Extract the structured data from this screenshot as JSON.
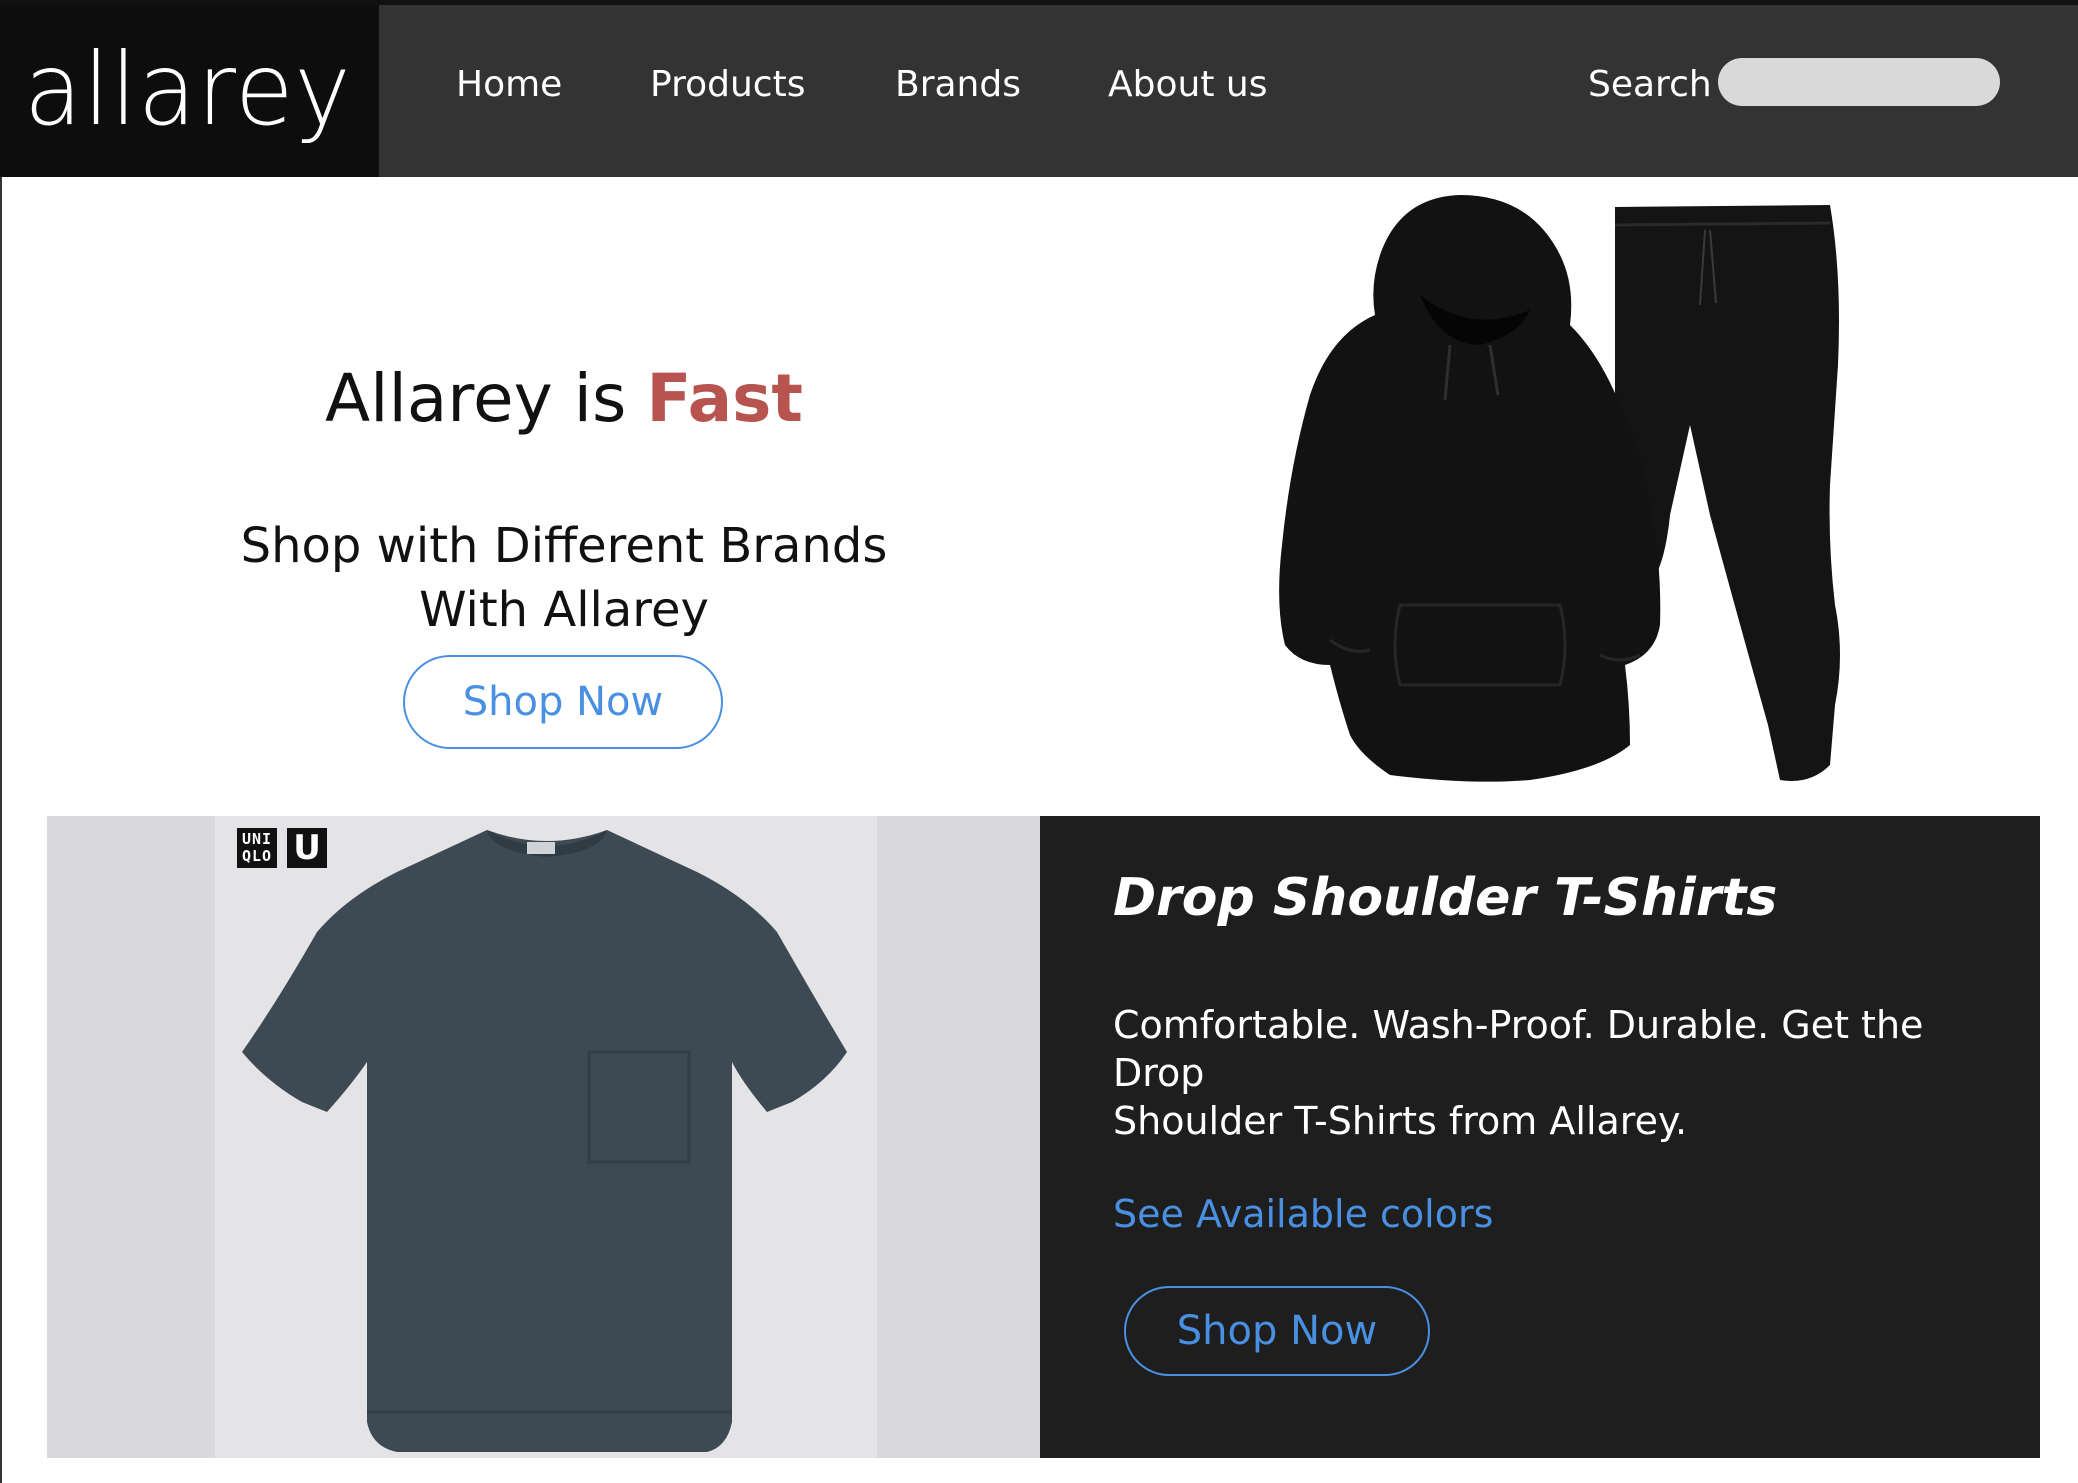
{
  "brand": {
    "logo_text": "allarey"
  },
  "nav": {
    "links": [
      {
        "label": "Home"
      },
      {
        "label": "Products"
      },
      {
        "label": "Brands"
      },
      {
        "label": "About us"
      }
    ],
    "search_label": "Search",
    "search_value": "",
    "search_placeholder": ""
  },
  "hero": {
    "title_prefix": "Allarey is",
    "title_accent": "Fast",
    "subtitle_line1": "Shop with Different Brands",
    "subtitle_line2": "With Allarey",
    "cta_label": "Shop Now",
    "image": "black-hoodie-and-joggers-set"
  },
  "promo": {
    "brand_badge_text": "UNI QLO",
    "brand_badge_u": "U",
    "image": "dark-gray-drop-shoulder-tshirt",
    "title": "Drop Shoulder T-Shirts",
    "description": "Comfortable. Wash-Proof. Durable. Get the\nDrop\nShoulder T-Shirts from Allarey.",
    "link_label": "See Available colors",
    "cta_label": "Shop Now"
  },
  "colors": {
    "nav_bg": "#333333",
    "logo_bg": "#0d0d0d",
    "accent_red": "#b85450",
    "link_blue": "#4a90e2",
    "promo_bg": "#1e1e1e",
    "photo_bg": "#d9d9db"
  }
}
